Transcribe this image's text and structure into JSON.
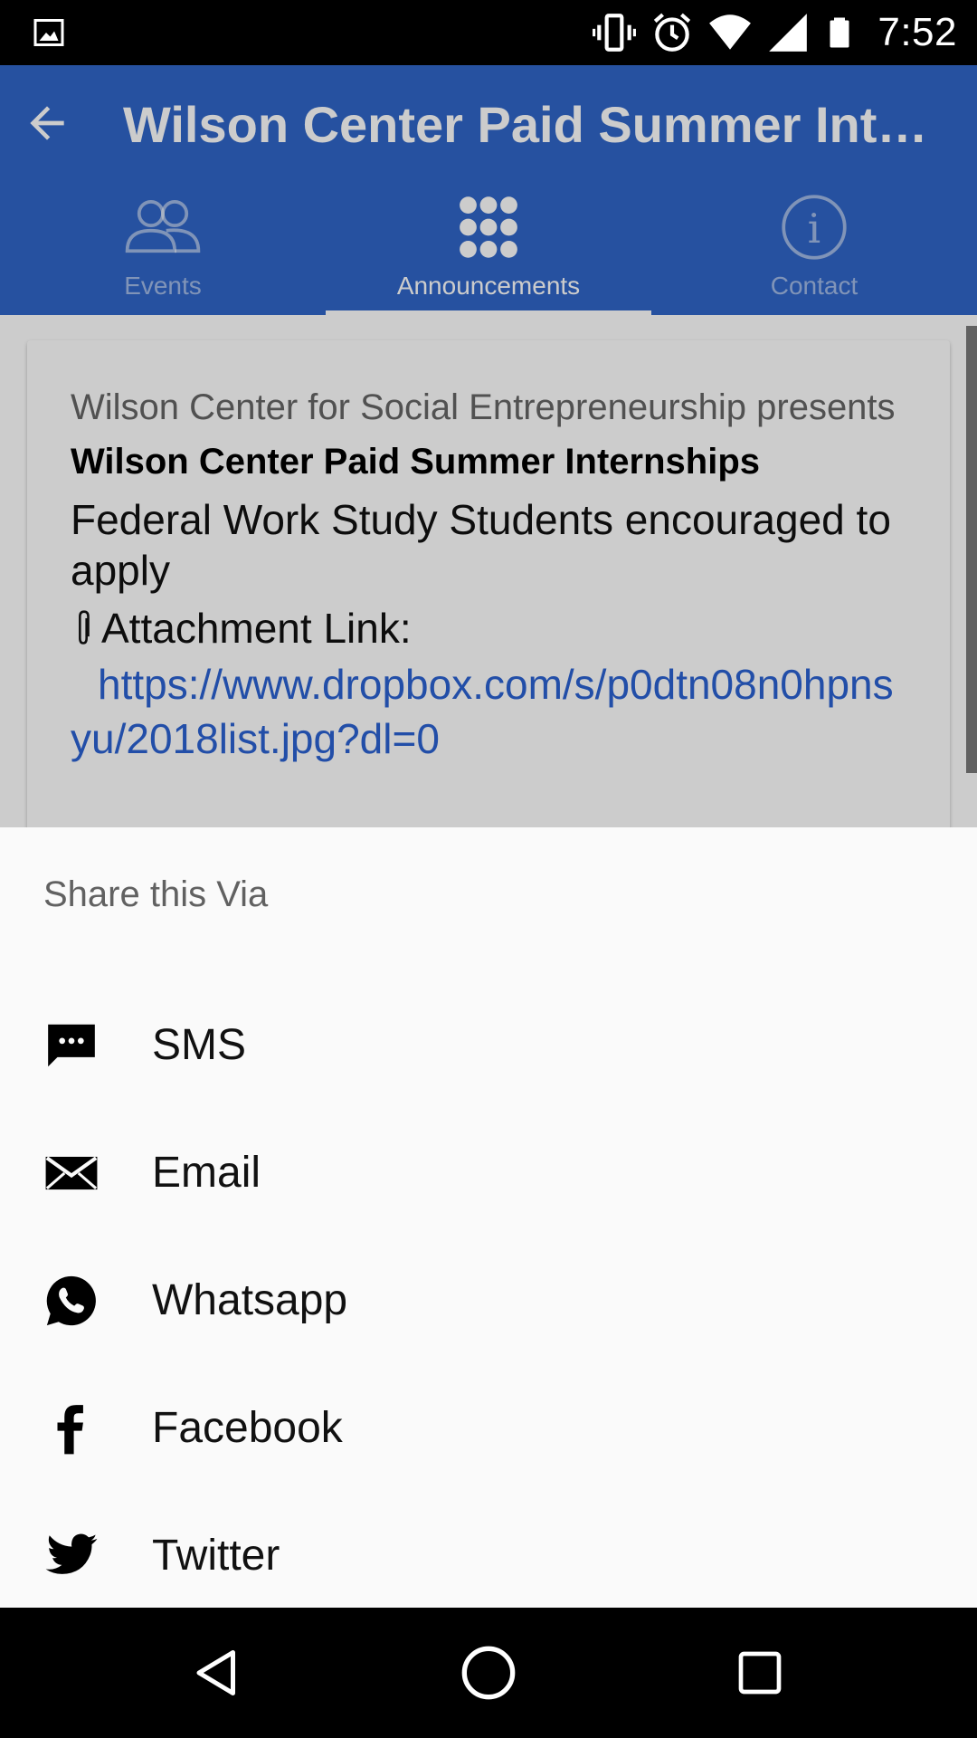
{
  "status_bar": {
    "time": "7:52",
    "icons": [
      "gallery-icon",
      "vibrate-icon",
      "alarm-icon",
      "wifi-icon",
      "signal-icon",
      "battery-icon"
    ]
  },
  "app_bar": {
    "title": "Wilson Center Paid Summer Internships",
    "color": "#3066c8",
    "tabs": [
      {
        "label": "Events",
        "icon": "people-icon",
        "active": false
      },
      {
        "label": "Announcements",
        "icon": "grid-icon",
        "active": true
      },
      {
        "label": "Contact",
        "icon": "info-icon",
        "active": false
      }
    ]
  },
  "announcement": {
    "presenter": "Wilson Center for Social Entrepreneurship presents",
    "title": "Wilson Center Paid Summer Internships",
    "body": "Federal Work Study Students encouraged to apply",
    "attachment_label": "Attachment Link:",
    "attachment_url": "https://www.dropbox.com/s/p0dtn08n0hpnsyu/2018list.jpg?dl=0",
    "link_color": "#2b62d2"
  },
  "share_sheet": {
    "title": "Share this Via",
    "options": [
      {
        "label": "SMS",
        "icon": "sms-icon"
      },
      {
        "label": "Email",
        "icon": "email-icon"
      },
      {
        "label": "Whatsapp",
        "icon": "whatsapp-icon"
      },
      {
        "label": "Facebook",
        "icon": "facebook-icon"
      },
      {
        "label": "Twitter",
        "icon": "twitter-icon"
      }
    ]
  },
  "nav_bar": {
    "buttons": [
      "back-nav-icon",
      "home-nav-icon",
      "recents-nav-icon"
    ]
  }
}
